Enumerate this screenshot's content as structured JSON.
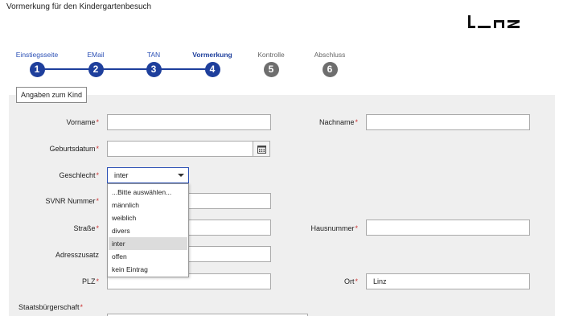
{
  "page": {
    "title": "Vormerkung für den Kindergartenbesuch"
  },
  "logo": {
    "text": "L_nz"
  },
  "stepper": {
    "steps": [
      {
        "label": "Einstiegsseite",
        "number": "1",
        "state": "completed"
      },
      {
        "label": "EMail",
        "number": "2",
        "state": "completed"
      },
      {
        "label": "TAN",
        "number": "3",
        "state": "completed"
      },
      {
        "label": "Vormerkung",
        "number": "4",
        "state": "active"
      },
      {
        "label": "Kontrolle",
        "number": "5",
        "state": "disabled"
      },
      {
        "label": "Abschluss",
        "number": "6",
        "state": "disabled"
      }
    ]
  },
  "section": {
    "tab_label": "Angaben zum Kind"
  },
  "form": {
    "vorname": {
      "label": "Vorname",
      "required": "*",
      "value": ""
    },
    "nachname": {
      "label": "Nachname",
      "required": "*",
      "value": ""
    },
    "geburtsdatum": {
      "label": "Geburtsdatum",
      "required": "*",
      "value": ""
    },
    "geschlecht": {
      "label": "Geschlecht",
      "required": "*",
      "value": "inter",
      "options": [
        "...Bitte auswählen...",
        "männlich",
        "weiblich",
        "divers",
        "inter",
        "offen",
        "kein Eintrag"
      ],
      "highlighted": "inter"
    },
    "svnr": {
      "label": "SVNR Nummer",
      "required": "*",
      "value": ""
    },
    "strasse": {
      "label": "Straße",
      "required": "*",
      "value": ""
    },
    "hausnummer": {
      "label": "Hausnummer",
      "required": "*",
      "value": ""
    },
    "adresszusatz": {
      "label": "Adresszusatz",
      "value": ""
    },
    "plz": {
      "label": "PLZ",
      "required": "*",
      "value": ""
    },
    "ort": {
      "label": "Ort",
      "required": "*",
      "value": "Linz"
    },
    "staatsbuergerschaft": {
      "label": "Staatsbürgerschaft",
      "required": "*"
    }
  },
  "colors": {
    "primary": "#1e3f9c",
    "disabled": "#6e6e6e",
    "panel": "#efefef",
    "required": "#cc3333"
  },
  "icons": {
    "calendar": "calendar-icon",
    "dropdown": "chevron-down-icon"
  }
}
